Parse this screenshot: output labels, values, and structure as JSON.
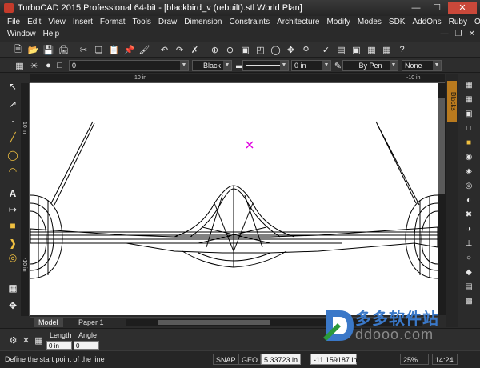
{
  "window": {
    "title": "TurboCAD 2015 Professional 64-bit - [blackbird_v (rebuilt).stl World Plan]"
  },
  "menu": {
    "row1": [
      "File",
      "Edit",
      "View",
      "Insert",
      "Format",
      "Tools",
      "Draw",
      "Dimension",
      "Constraints",
      "Architecture",
      "Modify",
      "Modes",
      "SDK",
      "AddOns",
      "Ruby",
      "Options"
    ],
    "row2": [
      "Window",
      "Help"
    ]
  },
  "property_bar": {
    "layer_value": "0",
    "color_value": "Black",
    "width_value": "0 in",
    "pen_value": "By Pen",
    "fill_value": "None"
  },
  "rulers": {
    "h_mark1": "10 in",
    "h_mark2": "-10 in",
    "v_mark1": "10 in",
    "v_mark2": "-10 in"
  },
  "right_panel": {
    "blocks_tab": "Blocks"
  },
  "tabs": [
    {
      "label": "Model",
      "active": true
    },
    {
      "label": "Paper 1",
      "active": false
    }
  ],
  "inspector": {
    "length_label": "Length",
    "angle_label": "Angle",
    "length_value": "0 in",
    "angle_value": "0"
  },
  "status": {
    "prompt": "Define the start point of the line",
    "snap": "SNAP",
    "geo": "GEO",
    "x_coord": "5.33723 in",
    "y_coord": "-11.159187 in",
    "zoom": "25%",
    "time": "14:24"
  },
  "watermark": {
    "cn": "多多软件站",
    "url": "ddooo.com"
  },
  "colors": {
    "accent": "#b97a1e",
    "cursor": "#e000e0",
    "canvas": "#ffffff",
    "chrome": "#2b2b2b"
  }
}
